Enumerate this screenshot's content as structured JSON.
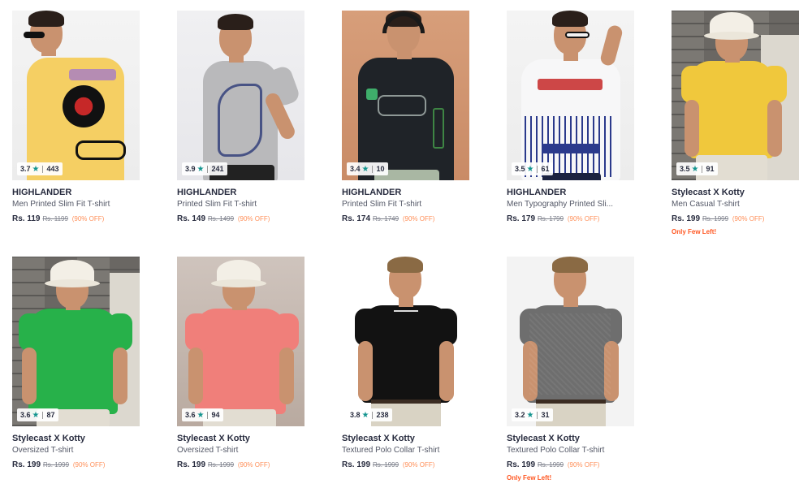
{
  "currency": "Rs.",
  "products": [
    {
      "brand": "HIGHLANDER",
      "title": "Men Printed Slim Fit T-shirt",
      "price": "Rs. 119",
      "mrp": "Rs. 1199",
      "discount": "(90% OFF)",
      "rating": "3.7",
      "count": "443",
      "few": ""
    },
    {
      "brand": "HIGHLANDER",
      "title": "Printed Slim Fit T-shirt",
      "price": "Rs. 149",
      "mrp": "Rs. 1499",
      "discount": "(90% OFF)",
      "rating": "3.9",
      "count": "241",
      "few": ""
    },
    {
      "brand": "HIGHLANDER",
      "title": "Printed Slim Fit T-shirt",
      "price": "Rs. 174",
      "mrp": "Rs. 1749",
      "discount": "(90% OFF)",
      "rating": "3.4",
      "count": "10",
      "few": ""
    },
    {
      "brand": "HIGHLANDER",
      "title": "Men Typography Printed Sli...",
      "price": "Rs. 179",
      "mrp": "Rs. 1799",
      "discount": "(90% OFF)",
      "rating": "3.5",
      "count": "61",
      "few": ""
    },
    {
      "brand": "Stylecast X Kotty",
      "title": "Men Casual T-shirt",
      "price": "Rs. 199",
      "mrp": "Rs. 1999",
      "discount": "(90% OFF)",
      "rating": "3.5",
      "count": "91",
      "few": "Only Few Left!"
    },
    {
      "brand": "Stylecast X Kotty",
      "title": "Oversized T-shirt",
      "price": "Rs. 199",
      "mrp": "Rs. 1999",
      "discount": "(90% OFF)",
      "rating": "3.6",
      "count": "87",
      "few": ""
    },
    {
      "brand": "Stylecast X Kotty",
      "title": "Oversized T-shirt",
      "price": "Rs. 199",
      "mrp": "Rs. 1999",
      "discount": "(90% OFF)",
      "rating": "3.6",
      "count": "94",
      "few": ""
    },
    {
      "brand": "Stylecast X Kotty",
      "title": "Textured Polo Collar T-shirt",
      "price": "Rs. 199",
      "mrp": "Rs. 1999",
      "discount": "(90% OFF)",
      "rating": "3.8",
      "count": "238",
      "few": ""
    },
    {
      "brand": "Stylecast X Kotty",
      "title": "Textured Polo Collar T-shirt",
      "price": "Rs. 199",
      "mrp": "Rs. 1999",
      "discount": "(90% OFF)",
      "rating": "3.2",
      "count": "31",
      "few": "Only Few Left!"
    }
  ],
  "colors": {
    "star": "#14958f",
    "discount": "#ff905a",
    "few_left": "#ff5722"
  },
  "icons": {
    "rating": "star-icon"
  }
}
